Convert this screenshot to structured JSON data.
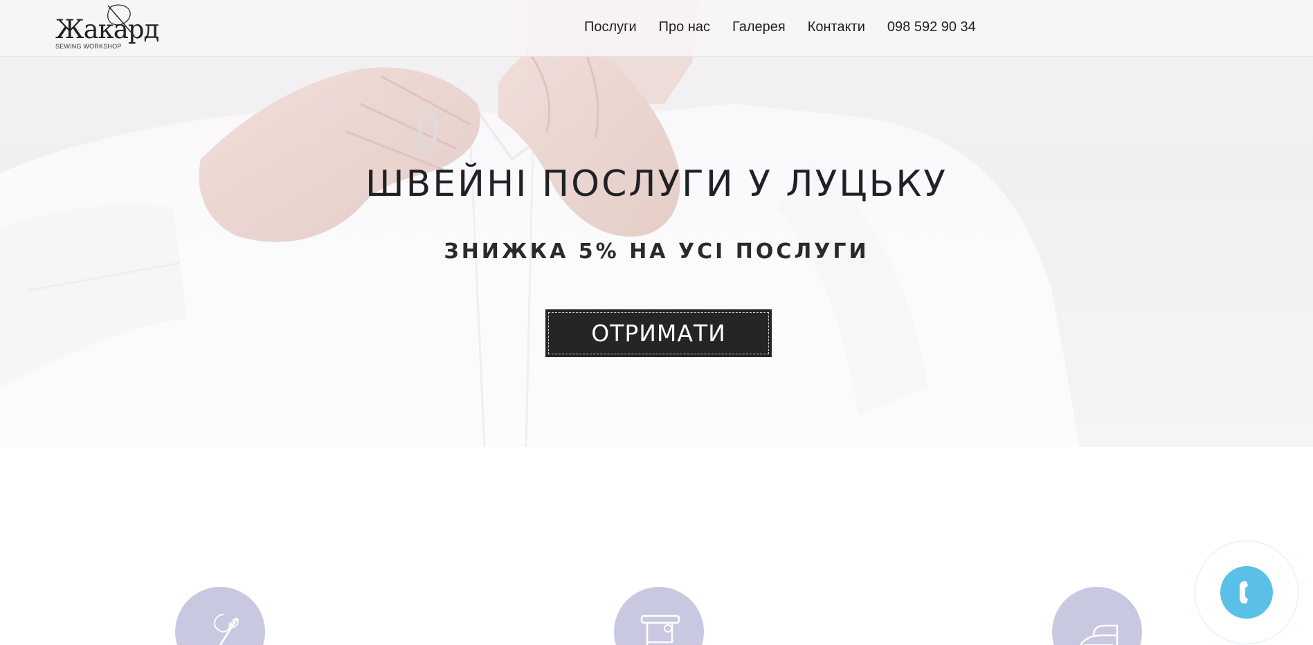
{
  "brand": {
    "logo_text": "Жакард",
    "logo_sub": "SEWING WORKSHOP"
  },
  "nav": {
    "items": [
      "Послуги",
      "Про нас",
      "Галерея",
      "Контакти"
    ],
    "phone": "098 592 90 34"
  },
  "hero": {
    "title": "ШВЕЙНІ ПОСЛУГИ У ЛУЦЬКУ",
    "subtitle": "ЗНИЖКА 5% НА УСІ ПОСЛУГИ",
    "cta_label": "ОТРИМАТИ"
  },
  "services": {
    "icons": [
      "needle-thread-icon",
      "sewing-machine-icon",
      "iron-icon"
    ]
  },
  "colors": {
    "service_circle": "#c9c8e1",
    "call_button": "#5bc0e8",
    "cta_background": "#252525",
    "title_text": "#202124"
  },
  "call_widget": {
    "icon": "phone-icon"
  }
}
